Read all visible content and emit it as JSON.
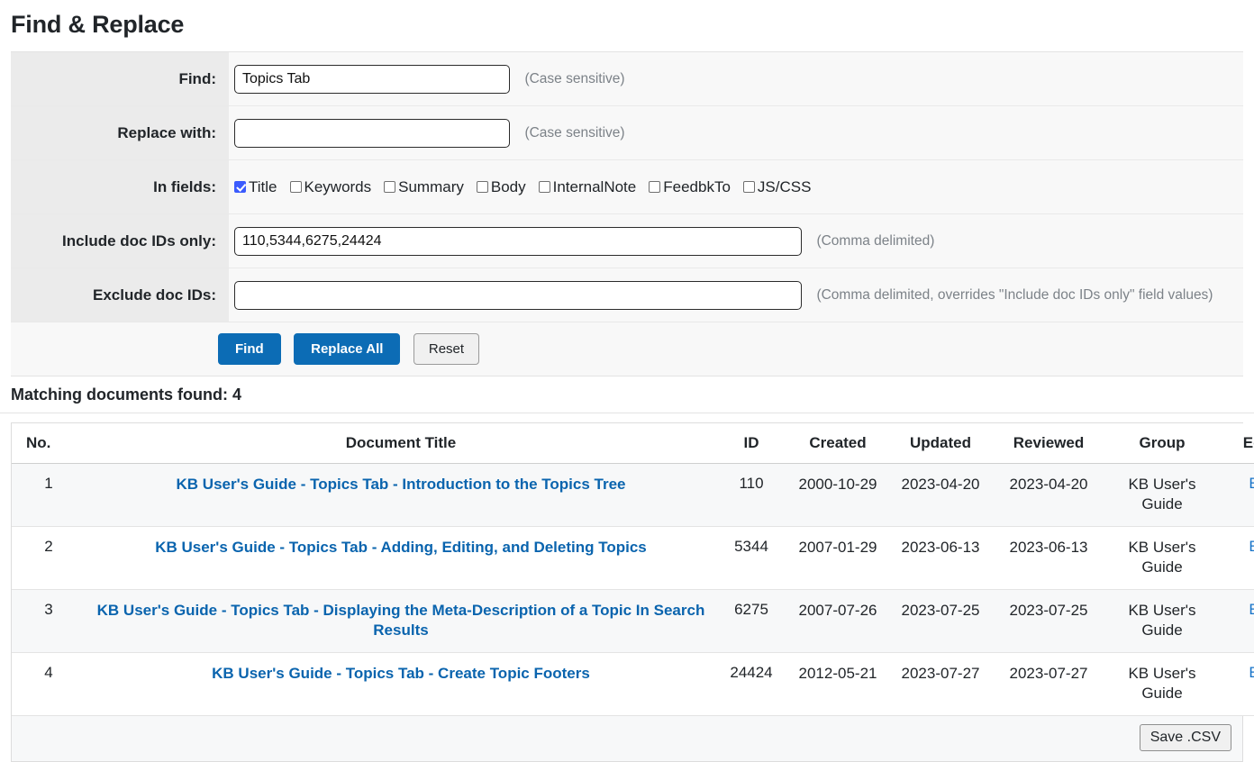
{
  "page": {
    "title": "Find & Replace"
  },
  "form": {
    "rows": {
      "find": {
        "label": "Find:",
        "value": "Topics Tab",
        "placeholder": "",
        "hint": "(Case sensitive)"
      },
      "replace": {
        "label": "Replace with:",
        "value": "",
        "placeholder": "",
        "hint": "(Case sensitive)"
      },
      "in_fields": {
        "label": "In fields:",
        "options": [
          {
            "label": "Title",
            "checked": true
          },
          {
            "label": "Keywords",
            "checked": false
          },
          {
            "label": "Summary",
            "checked": false
          },
          {
            "label": "Body",
            "checked": false
          },
          {
            "label": "InternalNote",
            "checked": false
          },
          {
            "label": "FeedbkTo",
            "checked": false
          },
          {
            "label": "JS/CSS",
            "checked": false
          }
        ]
      },
      "include_ids": {
        "label": "Include doc IDs only:",
        "value": "110,5344,6275,24424",
        "placeholder": "",
        "hint": "(Comma delimited)"
      },
      "exclude_ids": {
        "label": "Exclude doc IDs:",
        "value": "",
        "placeholder": "",
        "hint": "(Comma delimited, overrides \"Include doc IDs only\" field values)"
      }
    },
    "buttons": {
      "find": "Find",
      "replace_all": "Replace All",
      "reset": "Reset"
    }
  },
  "results": {
    "count_label": "Matching documents found: 4",
    "columns": {
      "no": "No.",
      "title": "Document Title",
      "id": "ID",
      "created": "Created",
      "updated": "Updated",
      "reviewed": "Reviewed",
      "group": "Group",
      "edit": "Edit?"
    },
    "rows": [
      {
        "no": "1",
        "title": "KB User's Guide - Topics Tab - Introduction to the Topics Tree",
        "id": "110",
        "created": "2000-10-29",
        "updated": "2023-04-20",
        "reviewed": "2023-04-20",
        "group": "KB User's Guide",
        "edit": "Edit"
      },
      {
        "no": "2",
        "title": "KB User's Guide - Topics Tab - Adding, Editing, and Deleting Topics",
        "id": "5344",
        "created": "2007-01-29",
        "updated": "2023-06-13",
        "reviewed": "2023-06-13",
        "group": "KB User's Guide",
        "edit": "Edit"
      },
      {
        "no": "3",
        "title": "KB User's Guide - Topics Tab - Displaying the Meta-Description of a Topic In Search Results",
        "id": "6275",
        "created": "2007-07-26",
        "updated": "2023-07-25",
        "reviewed": "2023-07-25",
        "group": "KB User's Guide",
        "edit": "Edit"
      },
      {
        "no": "4",
        "title": "KB User's Guide - Topics Tab - Create Topic Footers",
        "id": "24424",
        "created": "2012-05-21",
        "updated": "2023-07-27",
        "reviewed": "2023-07-27",
        "group": "KB User's Guide",
        "edit": "Edit"
      }
    ],
    "footer": {
      "save_csv": "Save .CSV"
    }
  },
  "colors": {
    "primary_button": "#0c6cb5",
    "link": "#0a64ae",
    "checkbox_checked": "#3b5bfd",
    "label_cell_bg": "#ebebeb"
  }
}
